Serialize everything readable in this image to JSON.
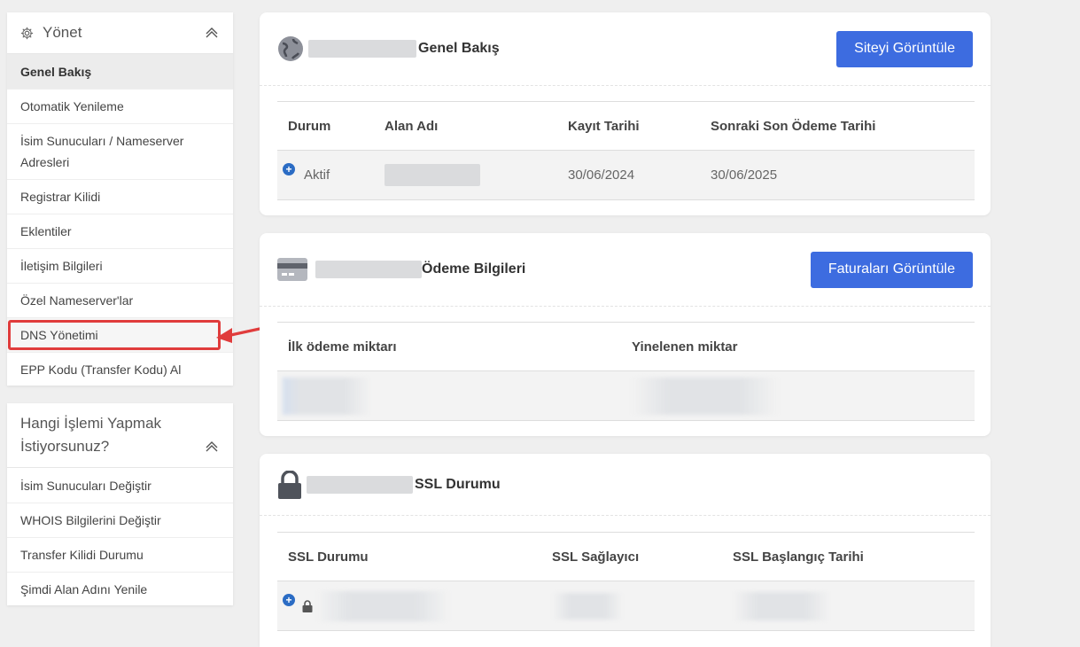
{
  "sidebar": {
    "manage": {
      "title": "Yönet",
      "items": [
        "Genel Bakış",
        "Otomatik Yenileme",
        "İsim Sunucuları / Nameserver Adresleri",
        "Registrar Kilidi",
        "Eklentiler",
        "İletişim Bilgileri",
        "Özel Nameserver'lar",
        "DNS Yönetimi",
        "EPP Kodu (Transfer Kodu) Al"
      ]
    },
    "actions": {
      "title": "Hangi İşlemi Yapmak İstiyorsunuz?",
      "items": [
        "İsim Sunucuları Değiştir",
        "WHOIS Bilgilerini Değiştir",
        "Transfer Kilidi Durumu",
        "Şimdi Alan Adını Yenile"
      ]
    }
  },
  "overview": {
    "title": "Genel Bakış",
    "button": "Siteyi Görüntüle",
    "headers": [
      "Durum",
      "Alan Adı",
      "Kayıt Tarihi",
      "Sonraki Son Ödeme Tarihi"
    ],
    "row": {
      "status": "Aktif",
      "registered": "30/06/2024",
      "next_due": "30/06/2025"
    }
  },
  "billing": {
    "title": "Ödeme Bilgileri",
    "button": "Faturaları Görüntüle",
    "headers": [
      "İlk ödeme miktarı",
      "Yinelenen miktar"
    ]
  },
  "ssl": {
    "title": "SSL Durumu",
    "headers": [
      "SSL Durumu",
      "SSL Sağlayıcı",
      "SSL Başlangıç Tarihi"
    ]
  },
  "icons": {
    "manage": "gear-icon",
    "collapse": "chevron-up-icon",
    "overview": "globe-icon",
    "billing": "credit-card-icon",
    "ssl": "lock-icon",
    "expand": "plus-circle-icon"
  },
  "colors": {
    "accent": "#3d6ce0",
    "highlight": "#e03c3c"
  }
}
